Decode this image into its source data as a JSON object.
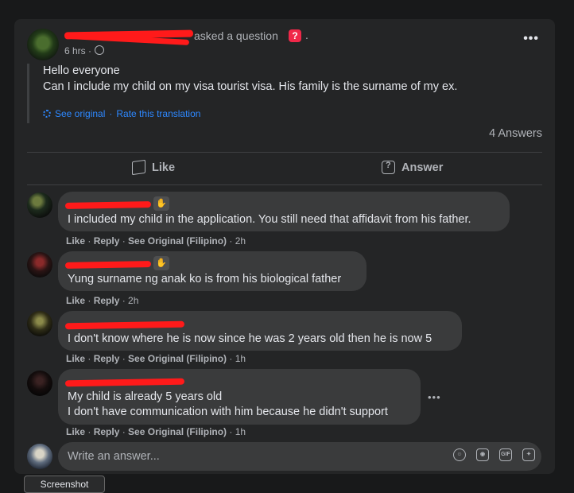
{
  "post": {
    "asked_text": "asked a question",
    "time": "6 hrs ·",
    "question_line1": "Hello everyone",
    "question_line2": "Can I include my child on my visa tourist visa. His family is the surname of my ex.",
    "see_original": "See original",
    "separator": "·",
    "rate_translation": "Rate this translation",
    "answers_count": "4 Answers",
    "more_label": "•••",
    "question_badge": "?",
    "dot_after_badge": "."
  },
  "actions": {
    "like": "Like",
    "answer": "Answer"
  },
  "comments": [
    {
      "text": "I included my child in the application. You still need that affidavit from his father.",
      "like": "Like",
      "reply": "Reply",
      "see_original": "See Original (Filipino)",
      "time": "2h"
    },
    {
      "text": "Yung surname ng anak ko is from his biological father",
      "like": "Like",
      "reply": "Reply",
      "time": "2h"
    },
    {
      "text": "I don't know where he is now since he was 2 years old then he is now 5",
      "like": "Like",
      "reply": "Reply",
      "see_original": "See Original (Filipino)",
      "time": "1h"
    },
    {
      "text_line1": "My child is already 5 years old",
      "text_line2": "I don't have communication with him because he didn't support",
      "like": "Like",
      "reply": "Reply",
      "see_original": "See Original (Filipino)",
      "time": "1h"
    }
  ],
  "comment_more": "•••",
  "write_answer": {
    "placeholder": "Write an answer..."
  },
  "write_icons": [
    "smiley-icon",
    "camera-icon",
    "gif-icon",
    "sticker-icon"
  ],
  "gif_text": "GIF",
  "tooltip": "Screenshot",
  "colors": {
    "background": "#18191a",
    "card": "#242526",
    "bubble": "#3a3b3c",
    "link": "#2d88ff",
    "redaction": "#ff1a1a",
    "badge": "#f02849"
  }
}
